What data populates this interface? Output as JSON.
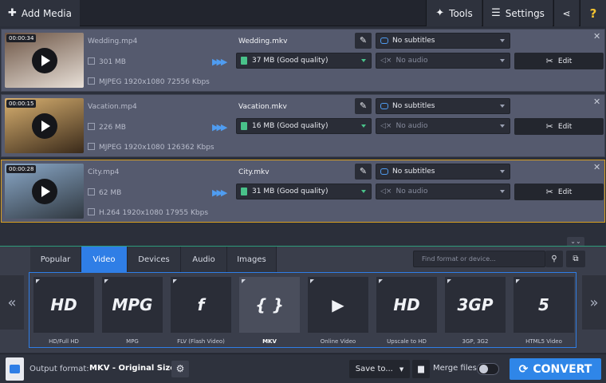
{
  "topbar": {
    "add_media": "Add Media",
    "tools": "Tools",
    "settings": "Settings"
  },
  "files": [
    {
      "duration": "00:00:34",
      "source_name": "Wedding.mp4",
      "source_size": "301 MB",
      "source_info": "MJPEG 1920x1080 72556 Kbps",
      "output_name": "Wedding.mkv",
      "output_quality": "37 MB (Good quality)",
      "subtitles": "No subtitles",
      "audio": "No audio",
      "edit_label": "Edit",
      "thumb_colors": [
        "#6c5444",
        "#e8e0d8"
      ],
      "selected": false
    },
    {
      "duration": "00:00:15",
      "source_name": "Vacation.mp4",
      "source_size": "226 MB",
      "source_info": "MJPEG 1920x1080 126362 Kbps",
      "output_name": "Vacation.mkv",
      "output_quality": "16 MB (Good quality)",
      "subtitles": "No subtitles",
      "audio": "No audio",
      "edit_label": "Edit",
      "thumb_colors": [
        "#d8b070",
        "#3a2a1a"
      ],
      "selected": false
    },
    {
      "duration": "00:00:28",
      "source_name": "City.mp4",
      "source_size": "62 MB",
      "source_info": "H.264 1920x1080 17955 Kbps",
      "output_name": "City.mkv",
      "output_quality": "31 MB (Good quality)",
      "subtitles": "No subtitles",
      "audio": "No audio",
      "edit_label": "Edit",
      "thumb_colors": [
        "#8aa8c8",
        "#303840"
      ],
      "selected": true
    }
  ],
  "formats": {
    "tabs": [
      "Popular",
      "Video",
      "Devices",
      "Audio",
      "Images"
    ],
    "active_tab": "Video",
    "search_placeholder": "Find format or device...",
    "items": [
      {
        "label": "HD/Full HD",
        "icon": "hd-video-icon",
        "mark": "HD"
      },
      {
        "label": "MPG",
        "icon": "mpg-video-icon",
        "mark": "MPG"
      },
      {
        "label": "FLV (Flash Video)",
        "icon": "flash-video-icon",
        "mark": "f"
      },
      {
        "label": "MKV",
        "icon": "mkv-icon",
        "mark": "{ }"
      },
      {
        "label": "Online Video",
        "icon": "youtube-play-icon",
        "mark": "▶"
      },
      {
        "label": "Upscale to HD",
        "icon": "sd-to-hd-icon",
        "mark": "HD"
      },
      {
        "label": "3GP, 3G2",
        "icon": "3gp-icon",
        "mark": "3GP"
      },
      {
        "label": "HTML5 Video",
        "icon": "html5-icon",
        "mark": "5"
      }
    ],
    "selected_index": 3
  },
  "bottombar": {
    "output_format_label": "Output format:",
    "output_format_value": "MKV - Original Size",
    "save_to": "Save to...",
    "merge_files": "Merge files:",
    "convert": "CONVERT"
  },
  "colors": {
    "accent": "#2f86e8",
    "selected_row_border": "#d9a020",
    "quality_green": "#49c28a"
  }
}
